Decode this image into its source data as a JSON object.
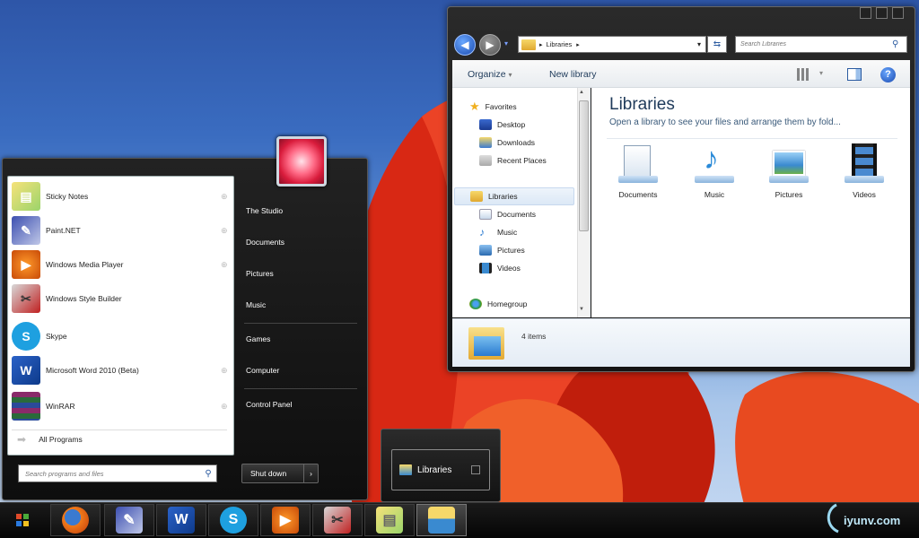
{
  "start_menu": {
    "programs": [
      {
        "label": "Sticky Notes",
        "icon": "sticky-notes-icon",
        "has_arrow": true
      },
      {
        "label": "Paint.NET",
        "icon": "paint-net-icon",
        "has_arrow": true
      },
      {
        "label": "Windows Media Player",
        "icon": "media-player-icon",
        "has_arrow": true
      },
      {
        "label": "Windows Style Builder",
        "icon": "style-builder-icon",
        "has_arrow": false
      },
      {
        "label": "Skype",
        "icon": "skype-icon",
        "has_arrow": false
      },
      {
        "label": "Microsoft Word 2010 (Beta)",
        "icon": "word-icon",
        "has_arrow": true
      },
      {
        "label": "WinRAR",
        "icon": "winrar-icon",
        "has_arrow": true
      }
    ],
    "all_programs": "All Programs",
    "search_placeholder": "Search programs and files",
    "right_items": [
      "The Studio",
      "Documents",
      "Pictures",
      "Music",
      "Games",
      "Computer",
      "Control Panel"
    ],
    "shutdown_label": "Shut down"
  },
  "explorer": {
    "address": "Libraries",
    "search_placeholder": "Search Libraries",
    "toolbar": {
      "organize": "Organize",
      "new_library": "New library"
    },
    "nav": {
      "favorites": "Favorites",
      "favorites_items": [
        "Desktop",
        "Downloads",
        "Recent Places"
      ],
      "libraries": "Libraries",
      "libraries_items": [
        "Documents",
        "Music",
        "Pictures",
        "Videos"
      ],
      "homegroup": "Homegroup"
    },
    "title": "Libraries",
    "subtitle": "Open a library to see your files and arrange them by fold...",
    "libraries": [
      "Documents",
      "Music",
      "Pictures",
      "Videos"
    ],
    "details": "4 items"
  },
  "preview": {
    "label": "Libraries"
  },
  "watermark": "iyunv.com",
  "colors": {
    "accent": "#2a5aa0",
    "title_blue": "#1e3a5a"
  }
}
